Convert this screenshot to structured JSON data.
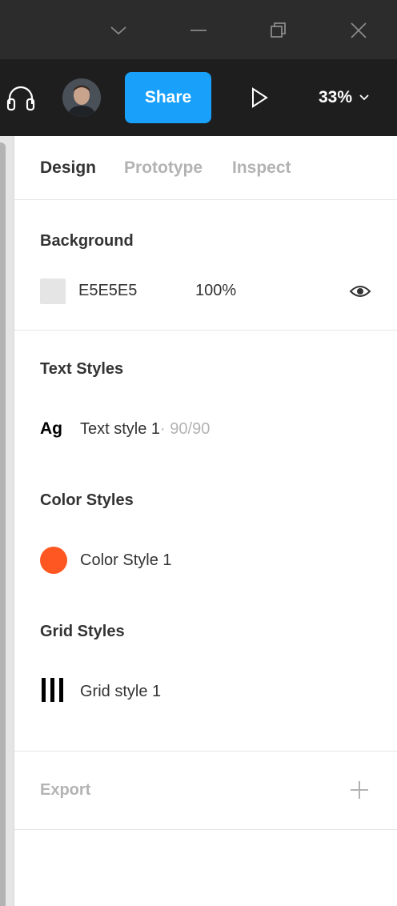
{
  "window_controls": {
    "dropdown_icon": "chevron-down-icon",
    "minimize_icon": "minimize-icon",
    "restore_icon": "restore-icon",
    "close_icon": "close-icon"
  },
  "toolbar": {
    "audio_icon": "headphones-icon",
    "avatar_icon": "user-avatar",
    "share_label": "Share",
    "play_icon": "play-icon",
    "zoom_value": "33%"
  },
  "tabs": [
    {
      "label": "Design",
      "active": true
    },
    {
      "label": "Prototype",
      "active": false
    },
    {
      "label": "Inspect",
      "active": false
    }
  ],
  "background": {
    "title": "Background",
    "color_hex": "E5E5E5",
    "swatch_color": "#E5E5E5",
    "opacity": "100%",
    "visibility_icon": "eye-icon"
  },
  "text_styles": {
    "title": "Text Styles",
    "icon_text": "Ag",
    "items": [
      {
        "name": "Text style 1",
        "meta": " · 90/90"
      }
    ]
  },
  "color_styles": {
    "title": "Color Styles",
    "items": [
      {
        "name": "Color Style 1",
        "color": "#FF5722"
      }
    ]
  },
  "grid_styles": {
    "title": "Grid Styles",
    "items": [
      {
        "name": "Grid style 1",
        "icon": "grid-columns-icon"
      }
    ]
  },
  "export": {
    "title": "Export",
    "add_icon": "plus-icon"
  },
  "colors": {
    "titlebar": "#2C2C2C",
    "toolbar": "#1E1E1E",
    "accent": "#18A0FB"
  }
}
